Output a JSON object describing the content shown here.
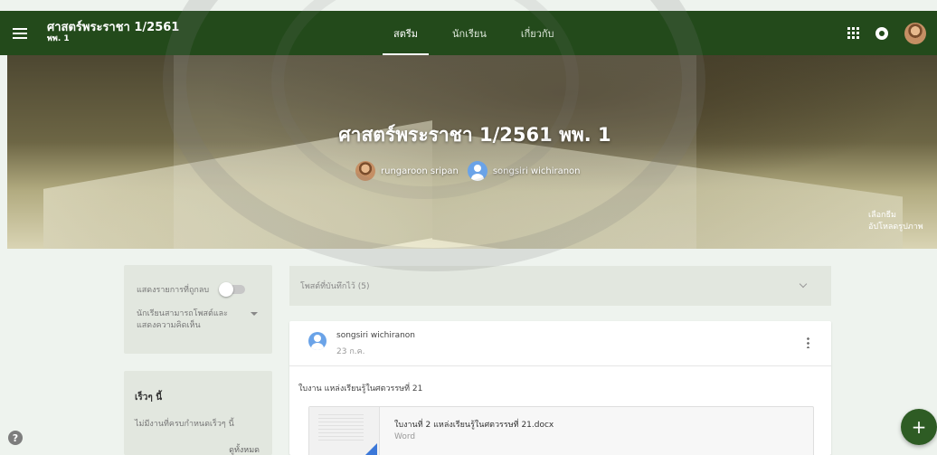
{
  "header": {
    "class_title": "ศาสตร์พระราชา 1/2561",
    "class_section": "พพ. 1",
    "tabs": [
      {
        "label": "สตรีม",
        "active": true
      },
      {
        "label": "นักเรียน",
        "active": false
      },
      {
        "label": "เกี่ยวกับ",
        "active": false
      }
    ],
    "icons": [
      "menu-icon",
      "apps-icon",
      "notification-icon",
      "avatar"
    ]
  },
  "banner": {
    "title": "ศาสตร์พระราชา 1/2561 พพ. 1",
    "teachers": [
      {
        "name": "rungaroon sripan",
        "avatar": "photo"
      },
      {
        "name": "songsiri wichiranon",
        "avatar": "default"
      }
    ],
    "select_theme": "เลือกธีม",
    "upload_photo": "อัปโหลดรูปภาพ"
  },
  "sidebar": {
    "show_deleted_label": "แสดงรายการที่ถูกลบ",
    "show_deleted_on": false,
    "student_permission": "นักเรียนสามารถโพสต์และแสดงความคิดเห็น",
    "upcoming_title": "เร็วๆ นี้",
    "upcoming_none": "ไม่มีงานที่ครบกำหนดเร็วๆ นี้",
    "view_all": "ดูทั้งหมด"
  },
  "stream": {
    "saved_posts": "โพสต์ที่บันทึกไว้ (5)",
    "post": {
      "author": "songsiri wichiranon",
      "date": "23 ก.ค.",
      "text": "ใบงาน แหล่งเรียนรู้ในศตวรรษที่ 21",
      "attachment": {
        "name": "ใบงานที่ 2 แหล่งเรียนรู้ในศตวรรษที่ 21.docx",
        "type": "Word"
      }
    }
  },
  "colors": {
    "header_bg": "#234a1b",
    "fab_bg": "#2e5c24",
    "page_bg": "#eef3ee"
  }
}
